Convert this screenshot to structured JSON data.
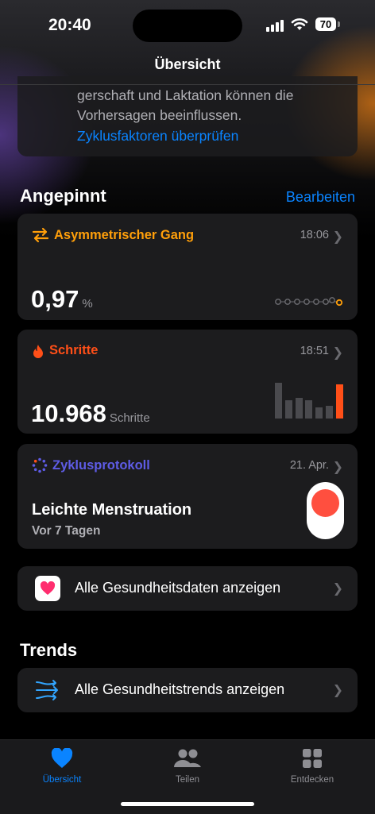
{
  "status": {
    "time": "20:40",
    "battery": "70"
  },
  "nav": {
    "title": "Übersicht"
  },
  "cycle_info": {
    "text": "gerschaft und Laktation können die Vorhersagen beeinflussen.",
    "link": "Zyklusfaktoren überprüfen"
  },
  "pinned": {
    "title": "Angepinnt",
    "edit": "Bearbeiten",
    "cards": [
      {
        "title": "Asymmetrischer Gang",
        "time": "18:06",
        "value": "0,97",
        "unit": "%",
        "color": "#ff9f0a"
      },
      {
        "title": "Schritte",
        "time": "18:51",
        "value": "10.968",
        "unit": "Schritte",
        "color": "#ff4f18",
        "bars": [
          0.9,
          0.45,
          0.52,
          0.45,
          0.28,
          0.32,
          0.85
        ]
      },
      {
        "title": "Zyklusprotokoll",
        "time": "21. Apr.",
        "value": "Leichte Menstruation",
        "sub": "Vor 7 Tagen",
        "color": "#5e5ce6"
      }
    ]
  },
  "all_health": {
    "label": "Alle Gesundheitsdaten anzeigen"
  },
  "trends": {
    "title": "Trends",
    "label": "Alle Gesundheitstrends anzeigen"
  },
  "tabs": [
    {
      "label": "Übersicht",
      "icon": "heart-icon",
      "active": true
    },
    {
      "label": "Teilen",
      "icon": "people-icon",
      "active": false
    },
    {
      "label": "Entdecken",
      "icon": "grid-icon",
      "active": false
    }
  ],
  "colors": {
    "accent": "#0a84ff",
    "orange": "#ff9f0a",
    "red": "#ff4f18",
    "purple": "#5e5ce6"
  }
}
